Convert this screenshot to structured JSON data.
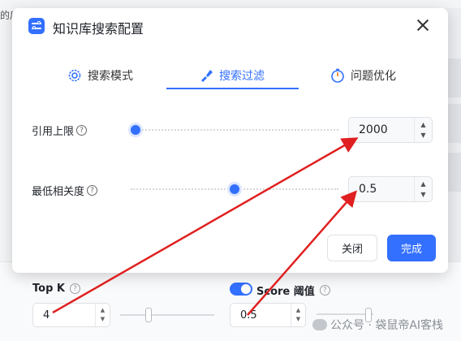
{
  "background": {
    "left_text": "的后",
    "top_k": {
      "label": "Top K",
      "value": "4",
      "slider_fraction": 0.3
    },
    "score": {
      "label": "Score 阈值",
      "value": "0.5",
      "enabled": true
    },
    "watermark": "公众号 · 袋鼠帝AI客栈"
  },
  "modal": {
    "title": "知识库搜索配置",
    "tabs": [
      {
        "label": "搜索模式",
        "icon": "gear-icon",
        "active": false
      },
      {
        "label": "搜索过滤",
        "icon": "filter-brush-icon",
        "active": true
      },
      {
        "label": "问题优化",
        "icon": "timer-icon",
        "active": false
      }
    ],
    "settings": [
      {
        "label": "引用上限",
        "value": "2000",
        "slider_fraction": 0.0
      },
      {
        "label": "最低相关度",
        "value": "0.5",
        "slider_fraction": 0.5
      }
    ],
    "buttons": {
      "close": "关闭",
      "done": "完成"
    }
  },
  "colors": {
    "accent": "#3370ff",
    "annotation": "#e02020"
  }
}
